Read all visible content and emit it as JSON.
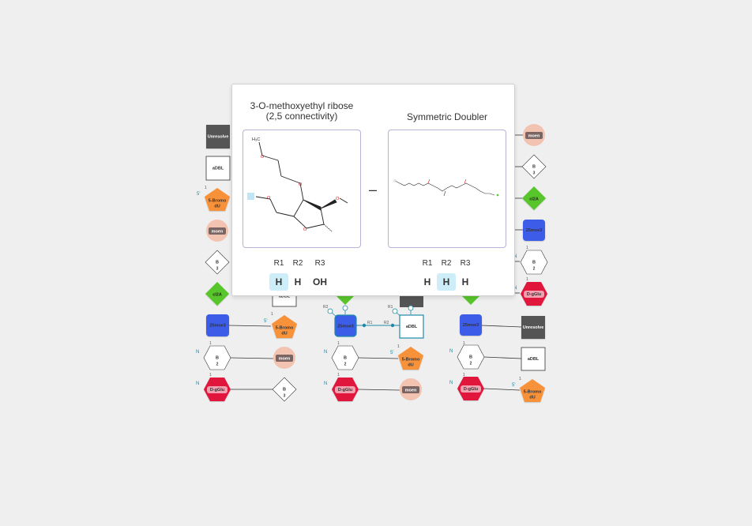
{
  "canvas": {
    "labels": {
      "unresolved": "Unresolve",
      "adbl": "aDBL",
      "bromo_line1": "5-Bromo",
      "bromo_line2": "dU",
      "moen": "moen",
      "b": "B",
      "n2": "2",
      "n3": "3",
      "cl2a": "cl2A",
      "moe": "25moe3",
      "dgglu": "D-gGlu"
    },
    "terminals": {
      "five_prime": "5'",
      "n_term": "N",
      "one": "1"
    },
    "attachments": {
      "r1": "R1",
      "r2": "R2"
    },
    "colors": {
      "unresolved": "#555555",
      "bromo": "#f7923a",
      "moen": "#f2c3b1",
      "moen_tag": "#7a6563",
      "cl2a": "#58c62b",
      "moe": "#3c5de8",
      "dgglu": "#e0143c",
      "selection": "#1e8aa8"
    }
  },
  "popup": {
    "left": {
      "title_line1": "3-O-methoxyethyl ribose",
      "title_line2": "(2,5 connectivity)",
      "structure_labels": {
        "h3c": "H₃C",
        "o": "O"
      },
      "rgroups": [
        {
          "name": "R1",
          "value": "H",
          "highlighted": true
        },
        {
          "name": "R2",
          "value": "H",
          "highlighted": false
        },
        {
          "name": "R3",
          "value": "OH",
          "highlighted": false
        }
      ]
    },
    "operator": "–",
    "right": {
      "title": "Symmetric Doubler",
      "rgroups": [
        {
          "name": "R1",
          "value": "H",
          "highlighted": false
        },
        {
          "name": "R2",
          "value": "H",
          "highlighted": true
        },
        {
          "name": "R3",
          "value": "H",
          "highlighted": false
        }
      ]
    }
  }
}
